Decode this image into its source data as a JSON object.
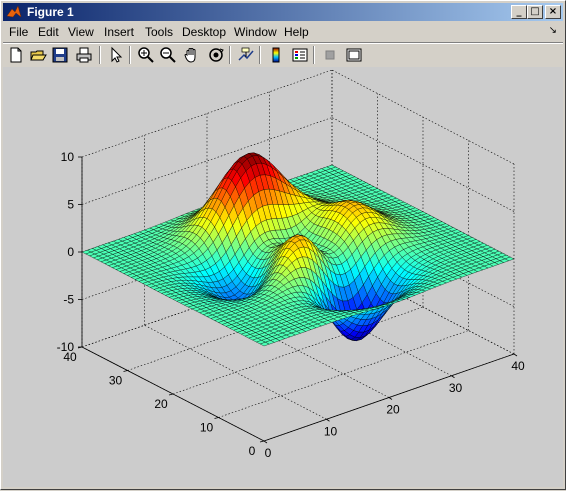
{
  "window": {
    "title": "Figure 1"
  },
  "title_buttons": {
    "minimize": "_",
    "maximize": "□",
    "close": "×"
  },
  "menu": {
    "items": [
      "File",
      "Edit",
      "View",
      "Insert",
      "Tools",
      "Desktop",
      "Window",
      "Help"
    ],
    "dock_arrow": "↘"
  },
  "toolbar": {
    "tools": [
      "new-figure",
      "open-file",
      "save-figure",
      "print-figure",
      "edit-plot-arrow",
      "zoom-in",
      "zoom-out",
      "pan-hand",
      "rotate-3d",
      "data-cursor",
      "insert-colorbar",
      "insert-legend",
      "hide-plot-tools",
      "show-plot-tools"
    ]
  },
  "chart_data": {
    "type": "surface",
    "function": "peaks",
    "grid": true,
    "colormap": "jet",
    "x_ticks": [
      "0",
      "10",
      "20",
      "30",
      "40"
    ],
    "y_ticks": [
      "0",
      "10",
      "20",
      "30",
      "40"
    ],
    "z_ticks": [
      "10",
      "5",
      "0",
      "-5",
      "-10"
    ],
    "xlim": [
      0,
      40
    ],
    "ylim": [
      0,
      40
    ],
    "zlim": [
      -10,
      10
    ],
    "mesh_size": 49
  }
}
